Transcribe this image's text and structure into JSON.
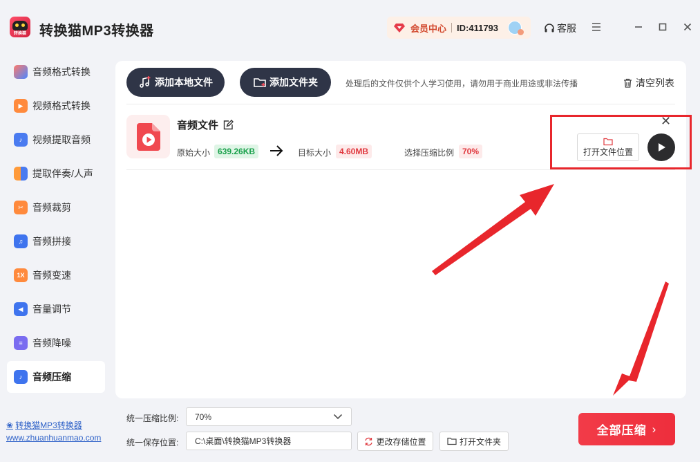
{
  "app": {
    "title": "转换猫MP3转换器",
    "logo_text": "转换猫",
    "member_center": "会员中心",
    "user_id": "ID:411793",
    "support": "客服"
  },
  "colors": {
    "accent": "#ee2e3c",
    "dark_button": "#2f3547",
    "size_green": "#1aa14c",
    "size_red": "#e0383e",
    "annotation_red": "#e8262c"
  },
  "sidebar": {
    "items": [
      {
        "label": "音频格式转换",
        "icon": "audio-format-icon"
      },
      {
        "label": "视频格式转换",
        "icon": "video-format-icon"
      },
      {
        "label": "视频提取音频",
        "icon": "video-extract-audio-icon"
      },
      {
        "label": "提取伴奏/人声",
        "icon": "extract-vocal-icon"
      },
      {
        "label": "音频裁剪",
        "icon": "audio-cut-icon"
      },
      {
        "label": "音频拼接",
        "icon": "audio-join-icon"
      },
      {
        "label": "音频变速",
        "icon": "audio-speed-icon",
        "icon_text": "1X"
      },
      {
        "label": "音量调节",
        "icon": "volume-icon"
      },
      {
        "label": "音频降噪",
        "icon": "denoise-icon"
      },
      {
        "label": "音频压缩",
        "icon": "audio-compress-icon",
        "active": true
      }
    ],
    "footer_name": "转换猫MP3转换器",
    "footer_url": "www.zhuanhuanmao.com"
  },
  "toolbar": {
    "add_local_file": "添加本地文件",
    "add_folder": "添加文件夹",
    "notice": "处理后的文件仅供个人学习使用，请勿用于商业用途或非法传播",
    "clear_list": "清空列表"
  },
  "file": {
    "name": "音频文件",
    "original_size_label": "原始大小",
    "original_size": "639.26KB",
    "target_size_label": "目标大小",
    "target_size": "4.60MB",
    "ratio_label": "选择压缩比例",
    "ratio": "70%",
    "open_location": "打开文件位置"
  },
  "bottom": {
    "ratio_label": "统一压缩比例:",
    "ratio_value": "70%",
    "save_label": "统一保存位置:",
    "save_path": "C:\\桌面\\转换猫MP3转换器",
    "change_location": "更改存储位置",
    "open_folder": "打开文件夹",
    "compress_all": "全部压缩"
  }
}
